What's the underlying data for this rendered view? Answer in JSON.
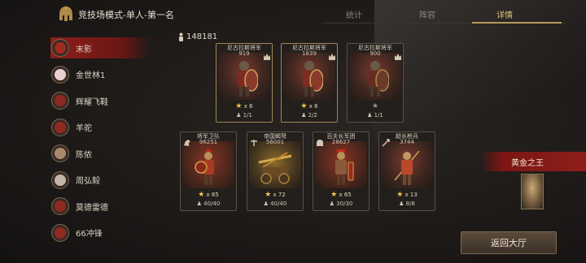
{
  "header": {
    "title": "竞技场模式-单人-第一名",
    "tabs": [
      {
        "label": "统计",
        "active": false
      },
      {
        "label": "阵容",
        "active": false
      },
      {
        "label": "详情",
        "active": true
      }
    ],
    "logo_icon": "spartan-helmet-icon"
  },
  "players": [
    {
      "name": "末影",
      "active": true,
      "avatar_color": "#a02a1e"
    },
    {
      "name": "金世林1",
      "active": false,
      "avatar_color": "#e8d0d2"
    },
    {
      "name": "辉耀飞鞋",
      "active": false,
      "avatar_color": "#8e2a22"
    },
    {
      "name": "羊驼",
      "active": false,
      "avatar_color": "#8e2a22"
    },
    {
      "name": "陈侬",
      "active": false,
      "avatar_color": "#a88a6a"
    },
    {
      "name": "周弘毅",
      "active": false,
      "avatar_color": "#c2b6a8"
    },
    {
      "name": "莫德雷德",
      "active": false,
      "avatar_color": "#8e2a22"
    },
    {
      "name": "66冲锋",
      "active": false,
      "avatar_color": "#8e2a22"
    }
  ],
  "resource": {
    "value": "148181",
    "icon": "troop-icon"
  },
  "commanders": [
    {
      "name": "尼古拉斯将军",
      "power": "919",
      "stars": "x 6",
      "units": "1/1",
      "star_color": "gold"
    },
    {
      "name": "尼古拉斯将军",
      "power": "1839",
      "stars": "x 6",
      "units": "2/2",
      "star_color": "gold"
    },
    {
      "name": "尼古拉斯将军",
      "power": "900",
      "stars": "",
      "units": "1/1",
      "star_color": "grey"
    }
  ],
  "units": [
    {
      "name": "将军卫队",
      "power": "96251",
      "stars": "x 85",
      "units": "40/40"
    },
    {
      "name": "帝国蝎弩",
      "power": "56001",
      "stars": "x 72",
      "units": "40/40"
    },
    {
      "name": "百夫长军团",
      "power": "28627",
      "stars": "x 65",
      "units": "30/30"
    },
    {
      "name": "超长枪兵",
      "power": "3744",
      "stars": "x 13",
      "units": "8/8"
    }
  ],
  "gold_king": {
    "label": "黄金之王"
  },
  "return_button": {
    "label": "返回大厅"
  },
  "colors": {
    "accent_gold": "#b89a5a",
    "active_red": "#8e1f1a",
    "star_gold": "#f0c84a"
  }
}
